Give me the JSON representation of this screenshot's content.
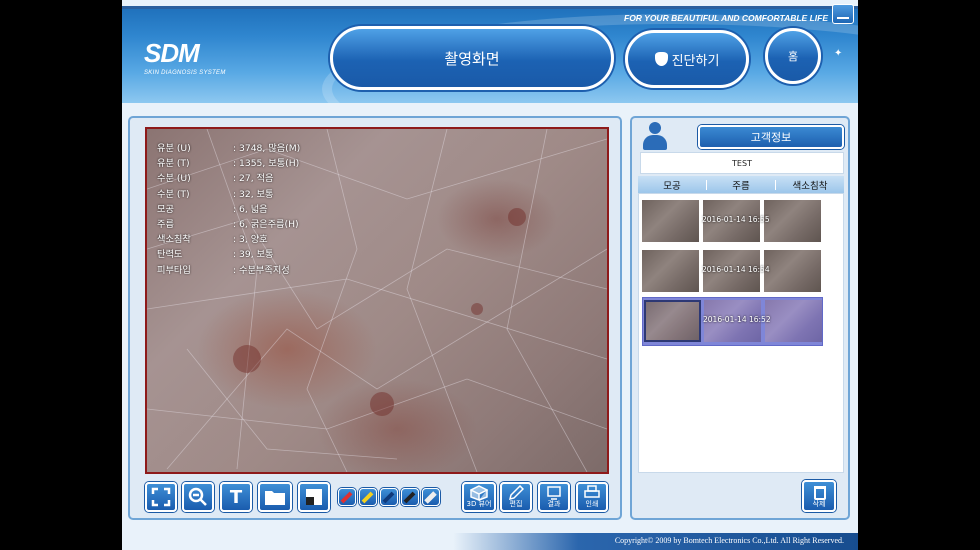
{
  "header": {
    "logo_title": "SDM",
    "logo_subtitle": "SKIN DIAGNOSIS SYSTEM",
    "slogan": "FOR YOUR BEAUTIFUL AND COMFORTABLE LIFE",
    "capture_label": "촬영화면",
    "diagnose_label": "진단하기",
    "home_label": "홈"
  },
  "readout": [
    {
      "key": "유분 (U)",
      "value": ": 3748, 많음(M)"
    },
    {
      "key": "유분 (T)",
      "value": ": 1355, 보통(H)"
    },
    {
      "key": "수분 (U)",
      "value": ": 27, 적음"
    },
    {
      "key": "수분 (T)",
      "value": ": 32, 보통"
    },
    {
      "key": "모공",
      "value": ": 6, 넓음"
    },
    {
      "key": "주름",
      "value": ": 6, 굵은주름(H)"
    },
    {
      "key": "색소침착",
      "value": ": 3, 양호"
    },
    {
      "key": "탄력도",
      "value": ": 39, 보통"
    },
    {
      "key": "피부타입",
      "value": ": 수분부족지성"
    }
  ],
  "toolbar": {
    "fit_icon": "fullscreen-icon",
    "zoom_icon": "zoom-out-icon",
    "text_label": "T",
    "folder_icon": "folder-icon",
    "layout_icon": "split-view-icon",
    "pens": [
      "red-pen-icon",
      "yellow-pen-icon",
      "blue-pen-icon",
      "dark-pen-icon",
      "eraser-icon"
    ],
    "viewer3d_label": "3D 뷰어",
    "edit_label": "편집",
    "result_label": "결과",
    "print_label": "인쇄"
  },
  "customer": {
    "tab_label": "고객정보",
    "name": "TEST",
    "columns": [
      "모공",
      "주름",
      "색소침착"
    ],
    "records": [
      {
        "stamp": "2016-01-14 16:55",
        "selected": false
      },
      {
        "stamp": "2016-01-14 16:54",
        "selected": false
      },
      {
        "stamp": "2016-01-14 16:52",
        "selected": true
      }
    ],
    "delete_label": "삭제"
  },
  "footer": {
    "copyright": "Copyright© 2009 by Bomtech Electronics Co.,Ltd.  All Right Reserved."
  },
  "colors": {
    "accent": "#1d5fae",
    "frame": "#8e1a1a",
    "selection": "#7f86d8"
  }
}
